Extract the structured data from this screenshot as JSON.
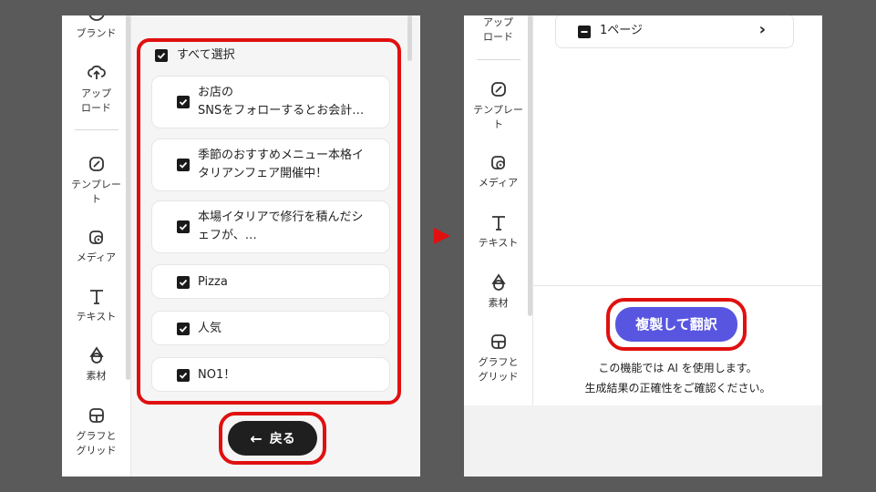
{
  "left_sidebar": {
    "items": [
      {
        "label": "ブランド"
      },
      {
        "label": "アップ\nロード"
      },
      {
        "label": "テンプレー\nト"
      },
      {
        "label": "メディア"
      },
      {
        "label": "テキスト"
      },
      {
        "label": "素材"
      },
      {
        "label": "グラフと\nグリッド"
      }
    ]
  },
  "right_sidebar": {
    "items": [
      {
        "label": "アップ\nロード"
      },
      {
        "label": "テンプレー\nト"
      },
      {
        "label": "メディア"
      },
      {
        "label": "テキスト"
      },
      {
        "label": "素材"
      },
      {
        "label": "グラフと\nグリッド"
      }
    ]
  },
  "left_main": {
    "select_all": "すべて選択",
    "items": [
      {
        "text": "お店の\nSNSをフォローするとお会計…"
      },
      {
        "text": "季節のおすすめメニュー本格イ\nタリアンフェア開催中！"
      },
      {
        "text": "本場イタリアで修行を積んだシ\nェフが、…"
      },
      {
        "text": "Pizza"
      },
      {
        "text": "人気"
      },
      {
        "text": "NO1！"
      }
    ],
    "back_button": "戻る"
  },
  "right_main": {
    "page_item": "1ページ",
    "translate_button": "複製して翻訳",
    "note_line1": "この機能では AI を使用します。",
    "note_line2": "生成結果の正確性をご確認ください。"
  },
  "colors": {
    "accent": "#5856e0",
    "highlight": "#e01010",
    "background": "#5a5a5a"
  }
}
